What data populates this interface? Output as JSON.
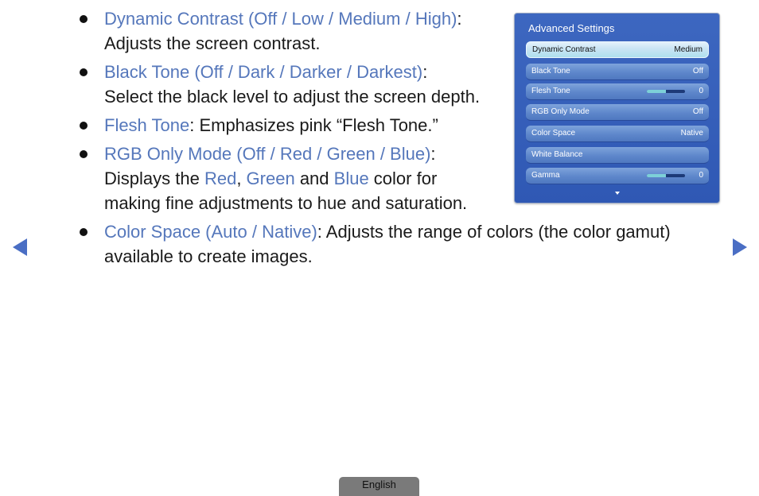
{
  "bullets": [
    {
      "title": "Dynamic Contrast (Off / Low / Medium / High)",
      "sep": ":",
      "line2": "Adjusts the screen contrast."
    },
    {
      "title": "Black Tone (Off / Dark / Darker / Darkest)",
      "sep": ":",
      "line2": "Select the black level to adjust the screen depth."
    },
    {
      "title": "Flesh Tone",
      "rest": ": Emphasizes pink “Flesh Tone.”"
    },
    {
      "title": "RGB Only Mode (Off / Red / Green / Blue)",
      "sep": ":",
      "line2_pre": "Displays the ",
      "red": "Red",
      "comma": ", ",
      "green": "Green",
      "and": " and ",
      "blue": "Blue",
      "line2_post": " color for",
      "line3": "making fine adjustments to hue and saturation."
    },
    {
      "title": "Color Space (Auto / Native)",
      "rest": ": Adjusts the range of colors (the color gamut)",
      "line2": "available to create images."
    }
  ],
  "panel": {
    "title": "Advanced Settings",
    "rows": [
      {
        "label": "Dynamic Contrast",
        "value": "Medium"
      },
      {
        "label": "Black Tone",
        "value": "Off"
      },
      {
        "label": "Flesh Tone",
        "value": "0",
        "slider_fraction": 0.5
      },
      {
        "label": "RGB Only Mode",
        "value": "Off"
      },
      {
        "label": "Color Space",
        "value": "Native"
      },
      {
        "label": "White Balance",
        "value": ""
      },
      {
        "label": "Gamma",
        "value": "0",
        "slider_fraction": 0.5
      }
    ]
  },
  "navigation": {
    "prev_icon": "triangle-left",
    "next_icon": "triangle-right"
  },
  "language_tab": "English",
  "colors": {
    "highlight": "#5577bb",
    "panel_bg": "#3d67c0",
    "arrow": "#4a6ec4"
  }
}
